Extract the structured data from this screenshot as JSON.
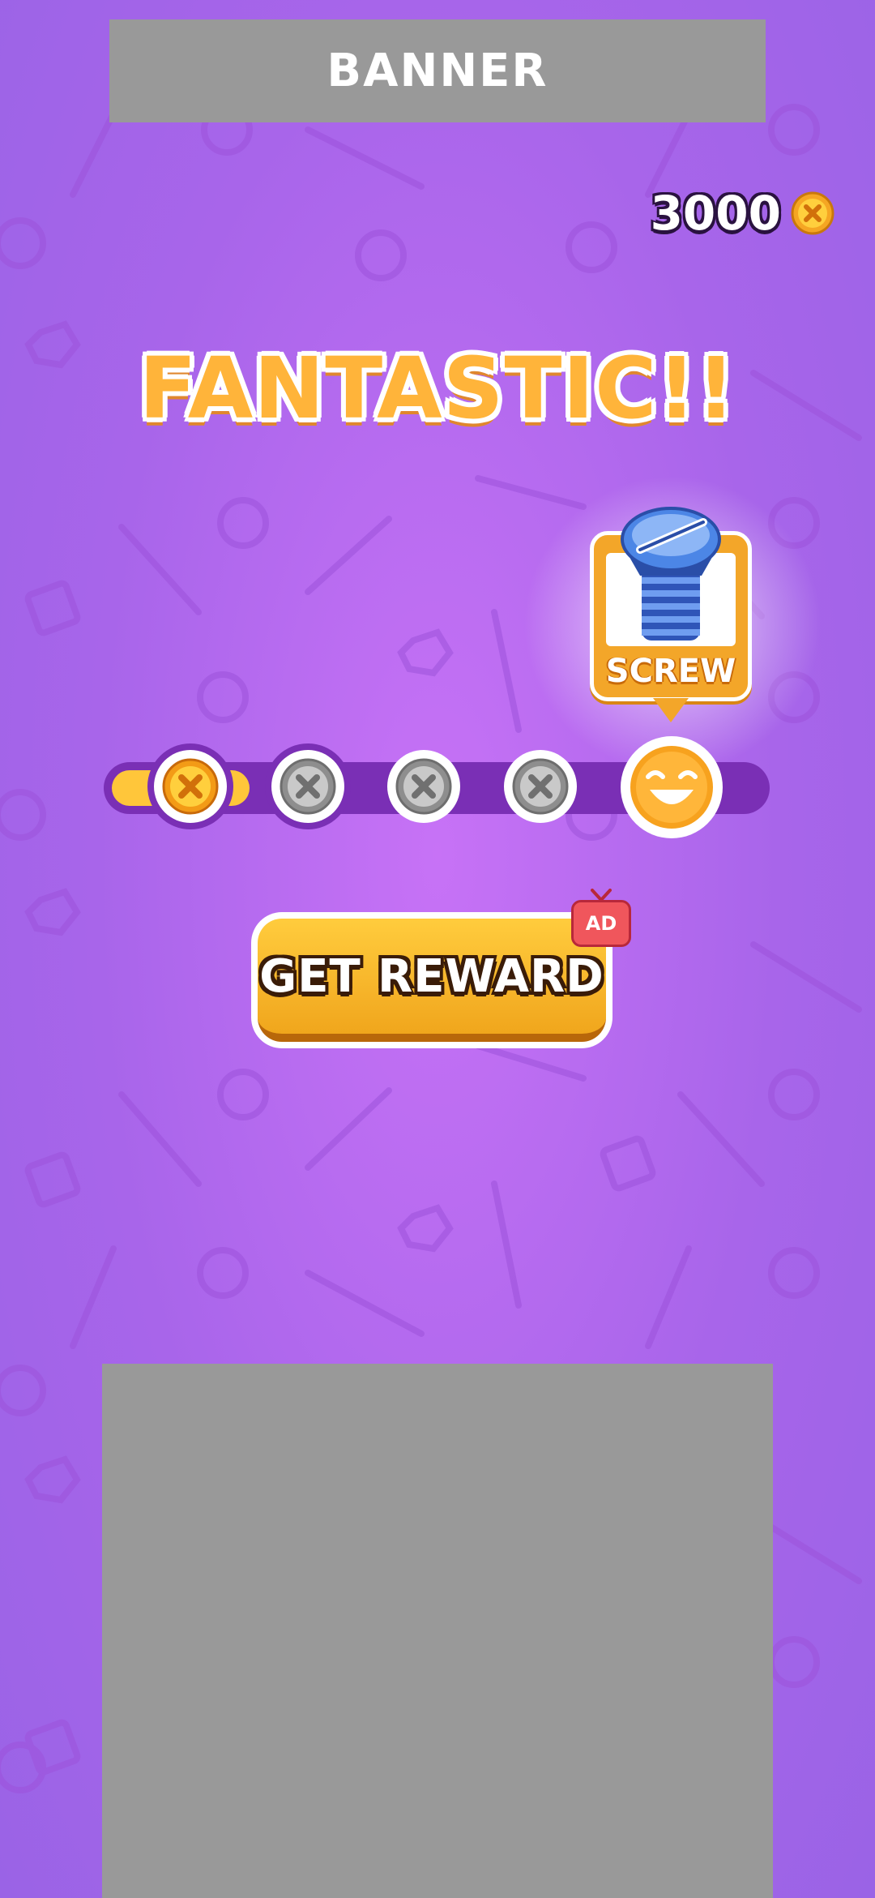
{
  "banner": {
    "label": "BANNER"
  },
  "currency": {
    "amount": "3000",
    "icon": "coin-icon"
  },
  "title": "FANTASTIC!!",
  "reward": {
    "label": "SCREW",
    "icon": "blue-screw-icon"
  },
  "progress": {
    "current_step": 1,
    "total_steps": 5,
    "nodes": [
      {
        "icon": "gold-screw-icon",
        "state": "completed"
      },
      {
        "icon": "silver-screw-icon",
        "state": "locked"
      },
      {
        "icon": "silver-screw-icon",
        "state": "locked"
      },
      {
        "icon": "silver-screw-icon",
        "state": "locked"
      },
      {
        "icon": "laughing-face-icon",
        "state": "goal"
      }
    ]
  },
  "button": {
    "label": "GET REWARD",
    "badge": "AD"
  },
  "colors": {
    "background": "#b06cf0",
    "accent": "#f3a629",
    "track": "#7a2fb5",
    "placeholder": "#999999"
  }
}
